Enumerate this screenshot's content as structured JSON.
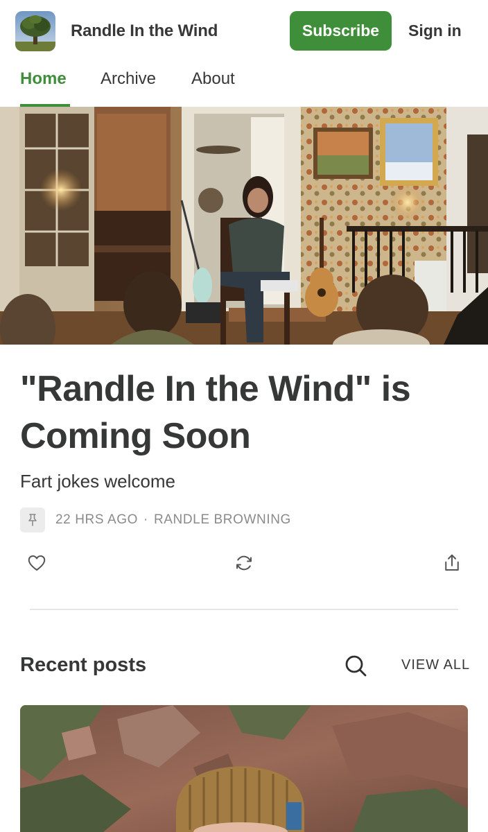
{
  "header": {
    "logo_icon": "tree-photo-logo",
    "site_name": "Randle In the Wind",
    "subscribe_label": "Subscribe",
    "signin_label": "Sign in"
  },
  "nav": {
    "tabs": [
      {
        "label": "Home",
        "active": true
      },
      {
        "label": "Archive",
        "active": false
      },
      {
        "label": "About",
        "active": false
      }
    ]
  },
  "hero": {
    "image": "living-room-concert-photo"
  },
  "post": {
    "title": "\"Randle In the Wind\" is Coming Soon",
    "subtitle": "Fart jokes welcome",
    "pin_icon": "pin-icon",
    "time": "22 HRS AGO",
    "separator": "·",
    "author": "RANDLE BROWNING",
    "actions": [
      "heart-icon",
      "restack-icon",
      "share-icon"
    ]
  },
  "recent": {
    "title": "Recent posts",
    "search_icon": "search-icon",
    "view_all_label": "VIEW ALL",
    "first_post_image": "beanie-portrait-canyon-photo"
  },
  "colors": {
    "accent": "#3f8f3a",
    "text": "#363737",
    "muted": "#8a8a8a"
  }
}
